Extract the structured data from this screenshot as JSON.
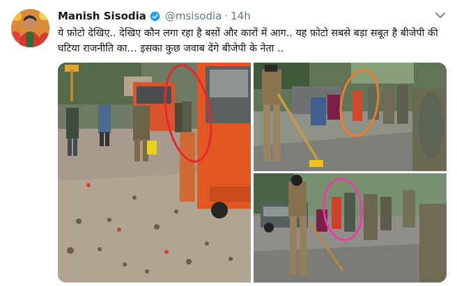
{
  "tweet": {
    "author_name": "Manish Sisodia",
    "handle": "@msisodia",
    "separator": "·",
    "time": "14h",
    "text": "ये फ़ोटो देखिए.. देखिए कौन लगा रहा है बसों और कारों में आग.. यह फ़ोटो सबसे बड़ा सबूत है बीजेपी की घटिया राजनीति का… इसका कुछ जवाब देंगे बीजेपी के नेता .."
  },
  "icons": {
    "verified": "verified-badge-icon",
    "menu": "chevron-down-icon"
  },
  "colors": {
    "verified_blue": "#1da1f2",
    "text_primary": "#14171a",
    "text_secondary": "#657786",
    "circle_red": "#e8262e",
    "circle_orange": "#f07b2a",
    "circle_pink": "#e63fa8",
    "bus_orange": "#e9531f"
  }
}
